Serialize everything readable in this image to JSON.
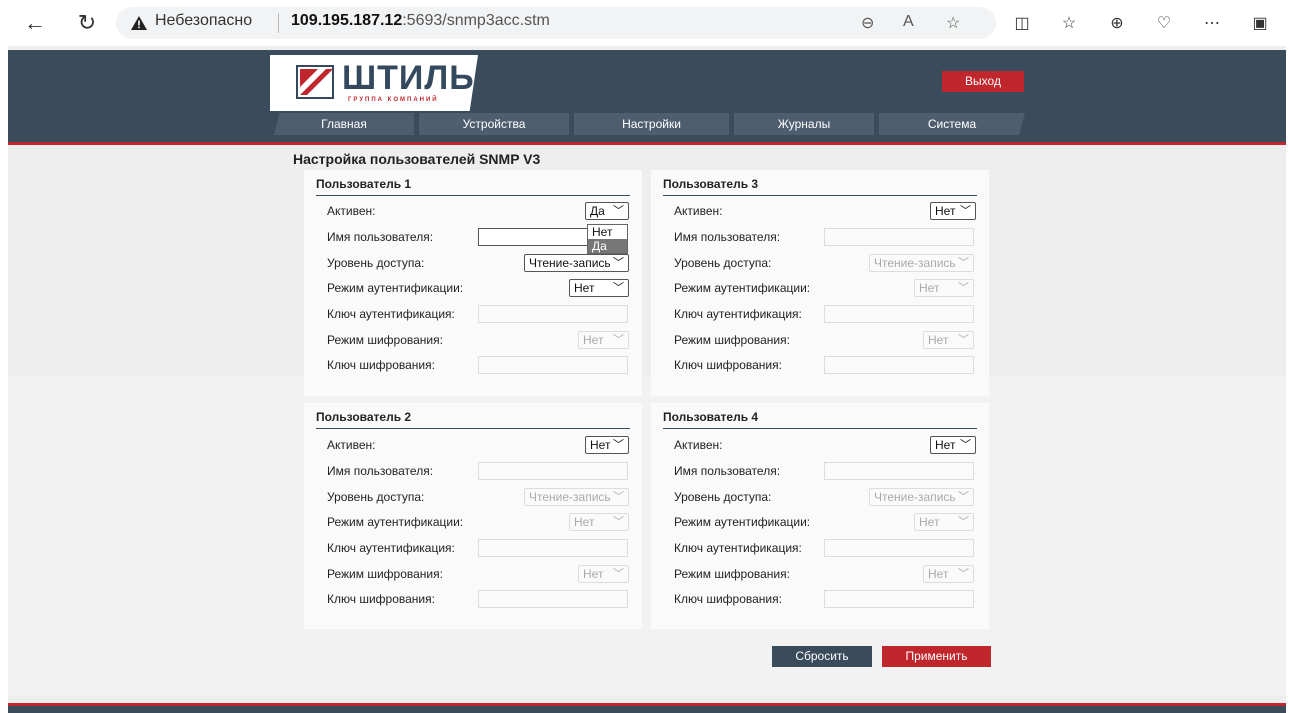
{
  "browser": {
    "insecure_label": "Небезопасно",
    "url_host": "109.195.187.12",
    "url_rest": ":5693/snmp3acc.stm"
  },
  "header": {
    "logo_text": "ШТИЛЬ",
    "logo_sub": "ГРУППА КОМПАНИЙ",
    "exit_label": "Выход",
    "menu": [
      {
        "label": "Главная"
      },
      {
        "label": "Устройства"
      },
      {
        "label": "Настройки"
      },
      {
        "label": "Журналы"
      },
      {
        "label": "Система"
      }
    ]
  },
  "content": {
    "title": "Настройка пользователей SNMP V3",
    "labels": {
      "active": "Активен:",
      "username": "Имя пользователя:",
      "access": "Уровень доступа:",
      "auth_mode": "Режим аутентификации:",
      "auth_key": "Ключ аутентификация:",
      "enc_mode": "Режим шифрования:",
      "enc_key": "Ключ шифрования:"
    },
    "users": [
      {
        "title": "Пользователь 1",
        "active": "Да",
        "access": "Чтение-запись",
        "auth_mode": "Нет",
        "enc_mode": "Нет"
      },
      {
        "title": "Пользователь 3",
        "active": "Нет",
        "access": "Чтение-запись",
        "auth_mode": "Нет",
        "enc_mode": "Нет"
      },
      {
        "title": "Пользователь 2",
        "active": "Нет",
        "access": "Чтение-запись",
        "auth_mode": "Нет",
        "enc_mode": "Нет"
      },
      {
        "title": "Пользователь 4",
        "active": "Нет",
        "access": "Чтение-запись",
        "auth_mode": "Нет",
        "enc_mode": "Нет"
      }
    ],
    "dropdown_options": [
      "Нет",
      "Да"
    ],
    "reset_label": "Сбросить",
    "apply_label": "Применить"
  },
  "colors": {
    "header_bg": "#3a4b5c",
    "accent_red": "#c0272d"
  }
}
